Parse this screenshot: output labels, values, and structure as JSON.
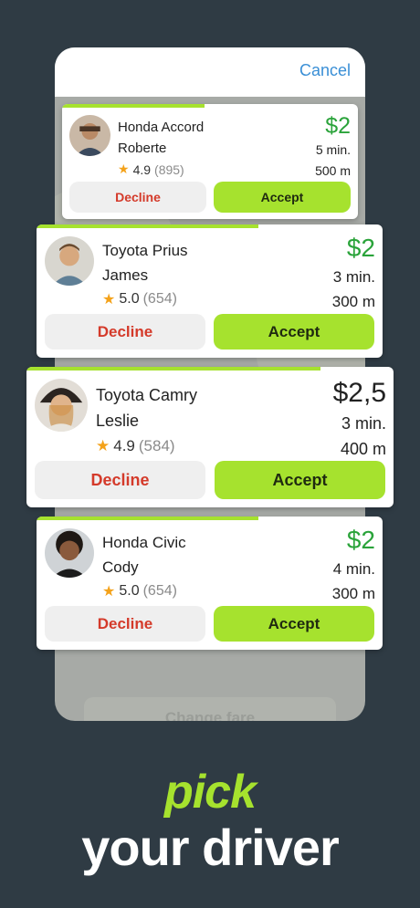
{
  "screen": {
    "cancel_label": "Cancel",
    "change_fare_label": "Change fare"
  },
  "offers": [
    {
      "car": "Honda Accord",
      "driver": "Roberte",
      "rating": "4.9",
      "reviews": "(895)",
      "price": "$2",
      "time": "5 min.",
      "distance": "500 m",
      "decline": "Decline",
      "accept": "Accept",
      "timer_progress": 0.48
    },
    {
      "car": "Toyota Prius",
      "driver": "James",
      "rating": "5.0",
      "reviews": "(654)",
      "price": "$2",
      "time": "3 min.",
      "distance": "300 m",
      "decline": "Decline",
      "accept": "Accept",
      "timer_progress": 0.64
    },
    {
      "car": "Toyota Camry",
      "driver": "Leslie",
      "rating": "4.9",
      "reviews": "(584)",
      "price": "$2,5",
      "time": "3 min.",
      "distance": "400 m",
      "decline": "Decline",
      "accept": "Accept",
      "timer_progress": 0.8
    },
    {
      "car": "Honda Civic",
      "driver": "Cody",
      "rating": "5.0",
      "reviews": "(654)",
      "price": "$2",
      "time": "4 min.",
      "distance": "300 m",
      "decline": "Decline",
      "accept": "Accept",
      "timer_progress": 0.64
    }
  ],
  "tagline": {
    "line1": "pick",
    "line2": "your driver"
  },
  "colors": {
    "accent": "#a6e22e",
    "price_green": "#2aa33a",
    "decline_red": "#d43a2a",
    "background": "#2f3b44",
    "cancel_blue": "#3a8fd6"
  }
}
